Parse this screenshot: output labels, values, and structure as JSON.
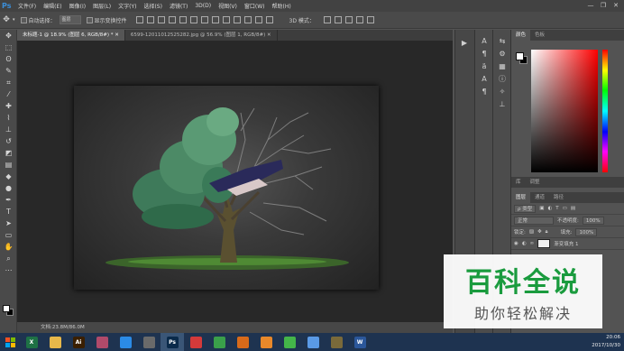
{
  "app": {
    "logo": "Ps"
  },
  "menu": {
    "items": [
      "文件(F)",
      "编辑(E)",
      "图像(I)",
      "图层(L)",
      "文字(Y)",
      "选择(S)",
      "滤镜(T)",
      "3D(D)",
      "视图(V)",
      "窗口(W)",
      "帮助(H)"
    ],
    "minimize": "—",
    "restore": "❐",
    "close": "✕"
  },
  "options": {
    "auto_select_label": "自动选择：",
    "auto_select_value": "图层",
    "transform_label": "显示变换控件",
    "mode3d_label": "3D 模式："
  },
  "tabs": [
    {
      "label": "未标题-1 @ 18.9% (图层 6, RGB/8#) *  ✕",
      "active": true
    },
    {
      "label": "6599-12011012525282.jpg @ 56.9% (图层 1, RGB/8#) ✕",
      "active": false
    }
  ],
  "status": {
    "doc": "文档:23.8M/86.0M"
  },
  "color_panel": {
    "tabs": [
      "颜色",
      "色板"
    ]
  },
  "adj_panel": {
    "tabs": [
      "库",
      "调整"
    ]
  },
  "layers_panel": {
    "tabs": [
      "图层",
      "通道",
      "路径"
    ],
    "kind_label": "ρ 类型",
    "blend_mode": "正常",
    "opacity_label": "不透明度:",
    "opacity_value": "100%",
    "lock_label": "锁定:",
    "fill_label": "填充:",
    "fill_value": "100%",
    "layer_name": "渐变填充 1"
  },
  "watermark": {
    "title": "百科全说",
    "subtitle": "助你轻松解决"
  },
  "tray": {
    "time": "20:06",
    "date": "2017/10/30"
  },
  "taskbar": {
    "apps": [
      {
        "icon": "excel-icon",
        "label": "X",
        "color": "#1e7145"
      },
      {
        "icon": "folder-icon",
        "label": "",
        "color": "#e8b84a"
      },
      {
        "icon": "illustrator-icon",
        "label": "Ai",
        "color": "#3a1f00"
      },
      {
        "icon": "paint-icon",
        "label": "",
        "color": "#b04a6a"
      },
      {
        "icon": "baidu-cloud-icon",
        "label": "",
        "color": "#2b8be6"
      },
      {
        "icon": "tool-icon",
        "label": "",
        "color": "#6a6a6a"
      },
      {
        "icon": "photoshop-icon",
        "label": "Ps",
        "color": "#0a2a4a"
      },
      {
        "icon": "video-icon",
        "label": "",
        "color": "#d43a3a"
      },
      {
        "icon": "browser-icon",
        "label": "",
        "color": "#3aa04a"
      },
      {
        "icon": "office-icon",
        "label": "",
        "color": "#d86a1a"
      },
      {
        "icon": "shield-icon",
        "label": "",
        "color": "#e8882a"
      },
      {
        "icon": "wechat-icon",
        "label": "",
        "color": "#44b549"
      },
      {
        "icon": "feed-icon",
        "label": "",
        "color": "#5a9ae6"
      },
      {
        "icon": "snake-icon",
        "label": "",
        "color": "#7a6a3a"
      },
      {
        "icon": "word-icon",
        "label": "W",
        "color": "#2b579a"
      }
    ]
  }
}
